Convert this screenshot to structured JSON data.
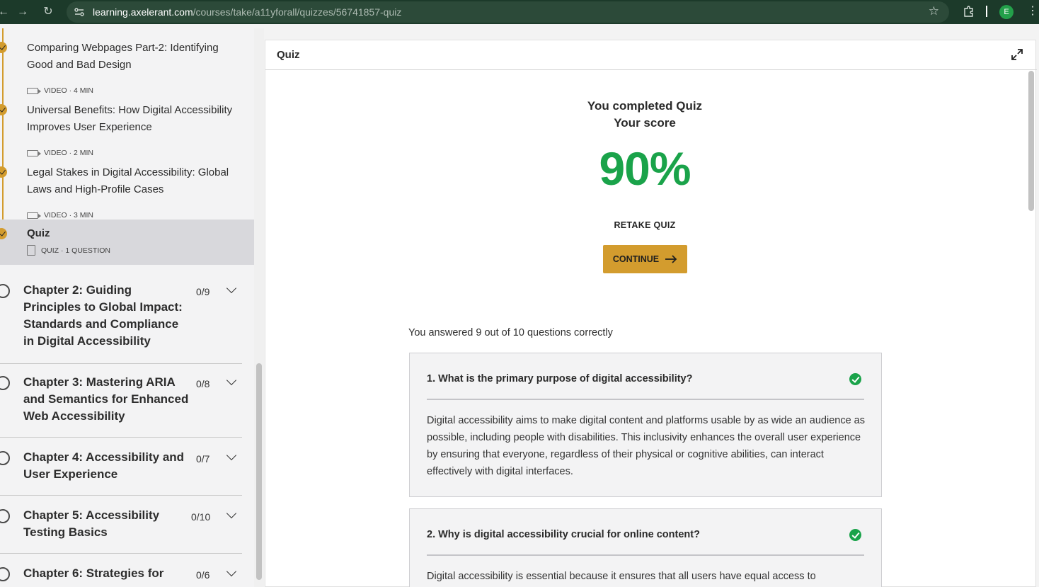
{
  "browser": {
    "url_host": "learning.axelerant.com",
    "url_path": "/courses/take/a11yforall/quizzes/56741857-quiz",
    "profile_initial": "E"
  },
  "sidebar": {
    "lessons": [
      {
        "title": "Comparing Webpages Part-2: Identifying Good and Bad Design",
        "meta": "VIDEO · 4 MIN"
      },
      {
        "title": "Universal Benefits: How Digital Accessibility Improves User Experience",
        "meta": "VIDEO · 2 MIN"
      },
      {
        "title": "Legal Stakes in Digital Accessibility: Global Laws and High-Profile Cases",
        "meta": "VIDEO · 3 MIN"
      },
      {
        "title": "Quiz",
        "meta": "QUIZ · 1 QUESTION"
      }
    ],
    "chapters": [
      {
        "title": "Chapter 2: Guiding Principles to Global Impact: Standards and Compliance in Digital Accessibility",
        "count": "0/9"
      },
      {
        "title": "Chapter 3: Mastering ARIA and Semantics for Enhanced Web Accessibility",
        "count": "0/8"
      },
      {
        "title": "Chapter 4: Accessibility and User Experience",
        "count": "0/7"
      },
      {
        "title": "Chapter 5: Accessibility Testing Basics",
        "count": "0/10"
      },
      {
        "title": "Chapter 6: Strategies for",
        "count": "0/6"
      }
    ]
  },
  "main": {
    "panel_title": "Quiz",
    "completed_line1": "You completed Quiz",
    "completed_line2": "Your score",
    "score": "90%",
    "retake_label": "RETAKE QUIZ",
    "continue_label": "CONTINUE",
    "answered_summary": "You answered 9 out of 10 questions correctly",
    "questions": [
      {
        "title": "1. What is the primary purpose of digital accessibility?",
        "explanation": "Digital accessibility aims to make digital content and platforms usable by as wide an audience as possible, including people with disabilities. This inclusivity enhances the overall user experience by ensuring that everyone, regardless of their physical or cognitive abilities, can interact effectively with digital interfaces."
      },
      {
        "title": "2. Why is digital accessibility crucial for online content?",
        "explanation": "Digital accessibility is essential because it ensures that all users have equal access to"
      }
    ]
  },
  "colors": {
    "accent": "#d39c2e",
    "success": "#1aa34a",
    "browser_bar": "#1c3a2a"
  }
}
